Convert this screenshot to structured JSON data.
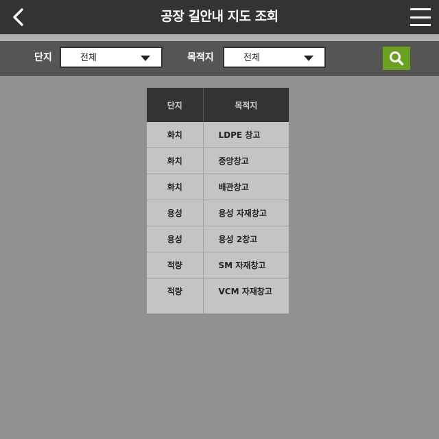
{
  "header": {
    "title": "공장 길안내 지도 조회",
    "back_icon": "chevron-left-icon",
    "menu_icon": "hamburger-menu-icon"
  },
  "filters": {
    "complex_label": "단지",
    "complex_value": "전체",
    "destination_label": "목적지",
    "destination_value": "전체",
    "search_icon": "search-icon",
    "search_color": "#6aa121"
  },
  "table": {
    "columns": [
      "단지",
      "목적지"
    ],
    "rows": [
      {
        "complex": "화치",
        "destination": "LDPE 창고"
      },
      {
        "complex": "화치",
        "destination": "중앙창고"
      },
      {
        "complex": "화치",
        "destination": "배관창고"
      },
      {
        "complex": "용성",
        "destination": "용성 자재창고"
      },
      {
        "complex": "용성",
        "destination": "용성 2창고"
      },
      {
        "complex": "적량",
        "destination": "SM 자재창고"
      },
      {
        "complex": "적량",
        "destination": "VCM 자재창고"
      }
    ]
  }
}
